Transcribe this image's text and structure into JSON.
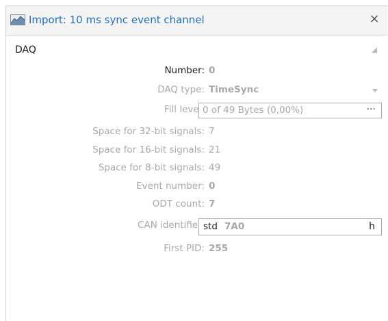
{
  "window": {
    "title": "Import: 10 ms sync event channel",
    "close_glyph": "×",
    "title_icon": "chart-area-icon"
  },
  "section": {
    "title": "DAQ",
    "collapse_icon": "collapse-triangle-icon"
  },
  "fields": {
    "number": {
      "label": "Number:",
      "value": "0"
    },
    "daq_type": {
      "label": "DAQ type:",
      "value": "TimeSync"
    },
    "fill_level": {
      "label": "Fill level:",
      "value": "0 of 49 Bytes (0,00%)",
      "button": "···"
    },
    "space32": {
      "label": "Space for 32-bit signals:",
      "value": "7"
    },
    "space16": {
      "label": "Space for 16-bit signals:",
      "value": "21"
    },
    "space8": {
      "label": "Space for 8-bit signals:",
      "value": "49"
    },
    "event_number": {
      "label": "Event number:",
      "value": "0"
    },
    "odt_count": {
      "label": "ODT count:",
      "value": "7"
    },
    "can_identifier": {
      "label": "CAN identifier:",
      "prefix": "std",
      "value": "7A0",
      "suffix": "h"
    },
    "first_pid": {
      "label": "First PID:",
      "value": "255"
    }
  },
  "colors": {
    "title": "#1e6fbf",
    "label_disabled": "#a8a8a8",
    "label_enabled": "#1a1a1a"
  }
}
